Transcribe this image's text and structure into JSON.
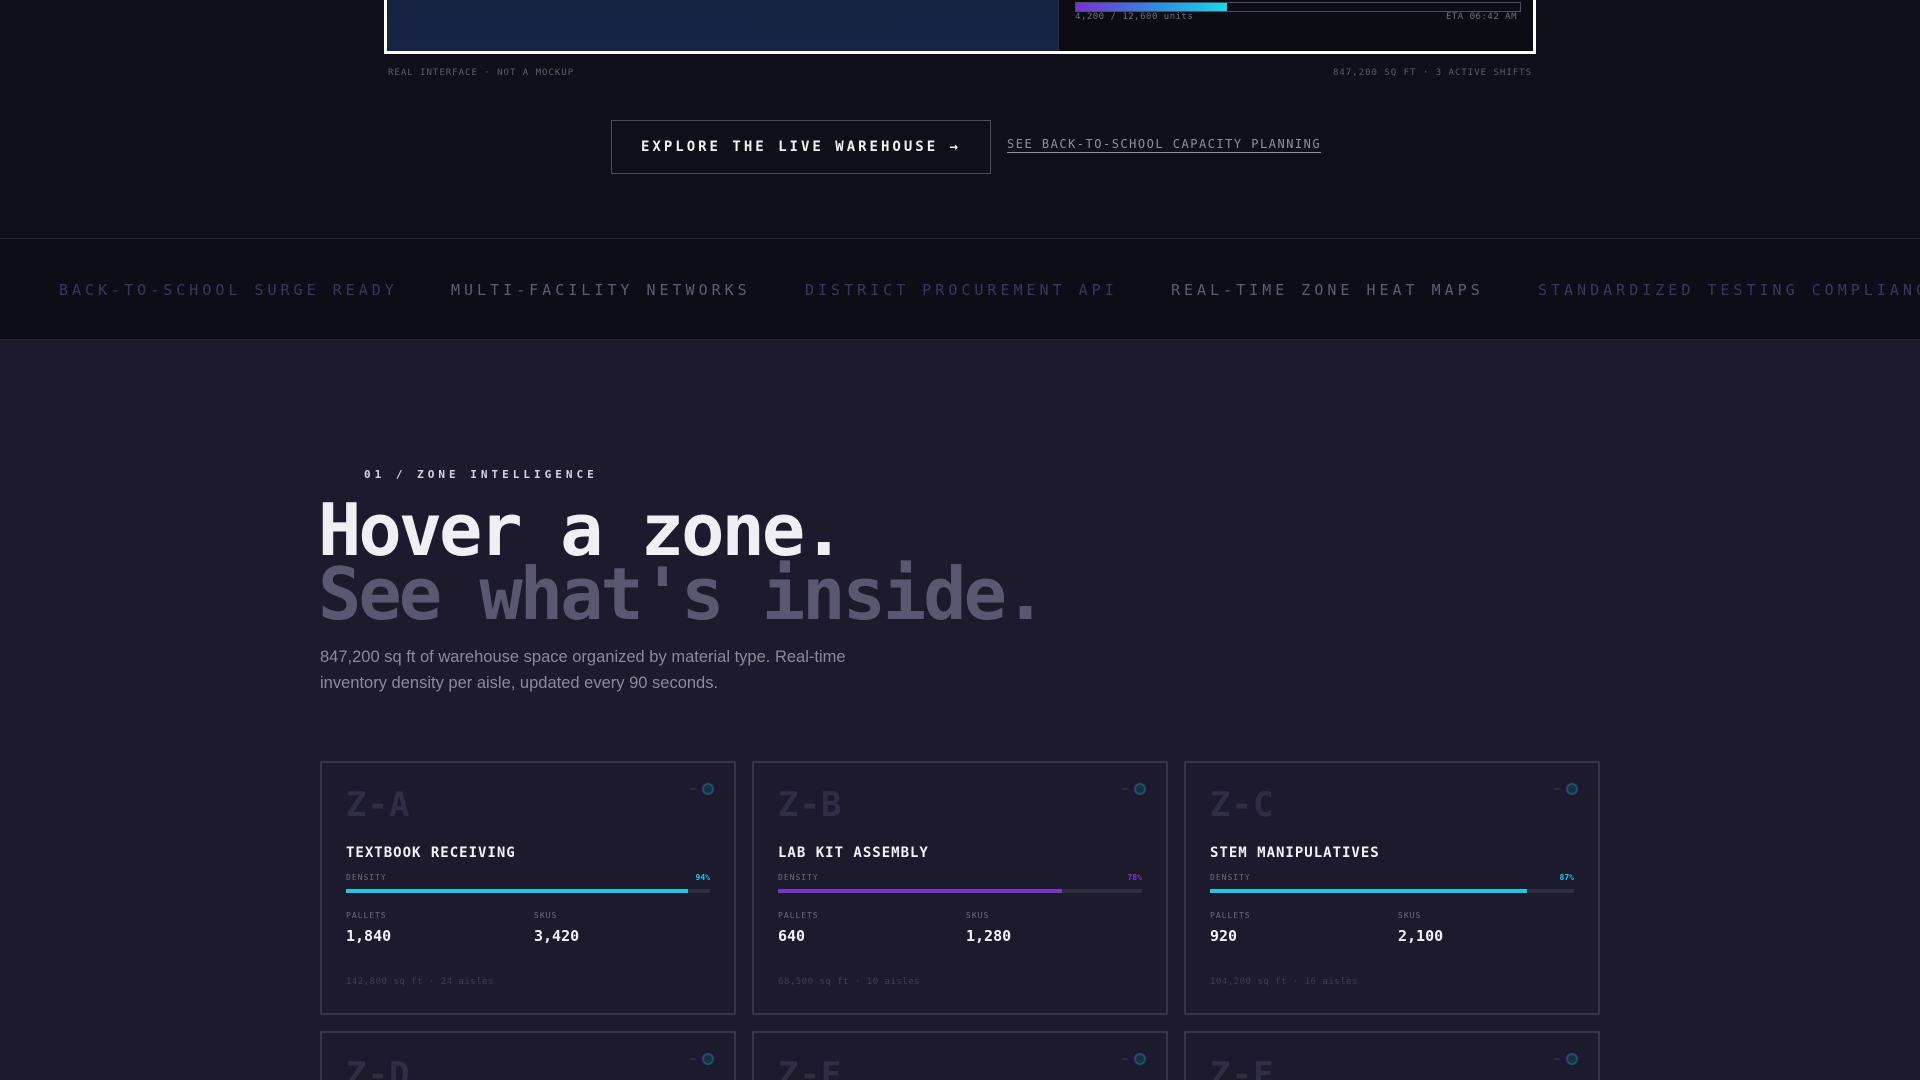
{
  "preview": {
    "progress_fraction": 0.34,
    "units_text": "4,200 / 12,600 units",
    "eta_text": "ETA 06:42 AM",
    "caption_left": "REAL INTERFACE · NOT A MOCKUP",
    "caption_right": "847,200 SQ FT · 3 ACTIVE SHIFTS"
  },
  "cta": {
    "primary_label": "EXPLORE THE LIVE WAREHOUSE →",
    "secondary_label": "SEE BACK-TO-SCHOOL CAPACITY PLANNING"
  },
  "marquee": {
    "items": [
      {
        "label": "BACK-TO-SCHOOL SURGE READY",
        "color": "#3e3460"
      },
      {
        "label": "MULTI-FACILITY NETWORKS",
        "color": "#5e5c74"
      },
      {
        "label": "DISTRICT PROCUREMENT API",
        "color": "#3e3460"
      },
      {
        "label": "REAL-TIME ZONE HEAT MAPS",
        "color": "#5e5c74"
      },
      {
        "label": "STANDARDIZED TESTING COMPLIANCE",
        "color": "#3e3460"
      }
    ]
  },
  "section": {
    "label": "01 / ZONE INTELLIGENCE",
    "headline_1": "Hover a zone.",
    "headline_2": "See what's inside.",
    "lede": "847,200 sq ft of warehouse space organized by material type. Real-time inventory density per aisle, updated every 90 seconds."
  },
  "labels": {
    "density": "DENSITY",
    "pallets": "PALLETS",
    "skus": "SKUS"
  },
  "zones": [
    {
      "code": "Z-A",
      "name": "TEXTBOOK RECEIVING",
      "density": "94%",
      "density_fraction": 0.94,
      "accent": "#1fc8dc",
      "pallets": "1,840",
      "skus": "3,420",
      "foot": "142,800 sq ft · 24 aisles"
    },
    {
      "code": "Z-B",
      "name": "LAB KIT ASSEMBLY",
      "density": "78%",
      "density_fraction": 0.78,
      "accent": "#7a36c8",
      "pallets": "640",
      "skus": "1,280",
      "foot": "68,500 sq ft · 10 aisles"
    },
    {
      "code": "Z-C",
      "name": "STEM MANIPULATIVES",
      "density": "87%",
      "density_fraction": 0.87,
      "accent": "#1fc8dc",
      "pallets": "920",
      "skus": "2,100",
      "foot": "104,200 sq ft · 16 aisles"
    },
    {
      "code": "Z-D"
    },
    {
      "code": "Z-E"
    },
    {
      "code": "Z-F"
    }
  ]
}
